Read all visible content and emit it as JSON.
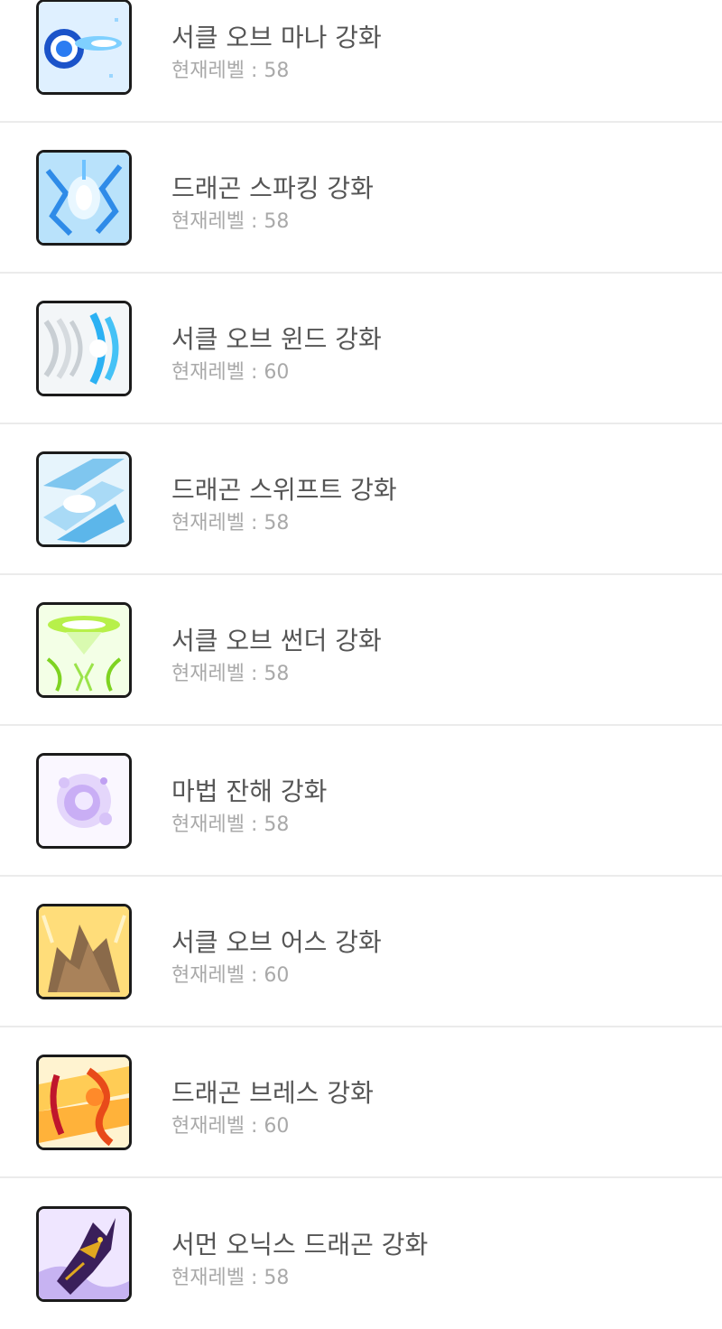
{
  "level_prefix": "현재레벨 : ",
  "skills": [
    {
      "name": "서클 오브 마나 강화",
      "level_text": "현재레벨 : 58",
      "icon": "circle-of-mana-icon",
      "color": "#2f8ff0"
    },
    {
      "name": "드래곤 스파킹 강화",
      "level_text": "현재레벨 : 58",
      "icon": "dragon-sparking-icon",
      "color": "#3aa7f0"
    },
    {
      "name": "서클 오브 윈드 강화",
      "level_text": "현재레벨 : 60",
      "icon": "circle-of-wind-icon",
      "color": "#2db4f5"
    },
    {
      "name": "드래곤 스위프트 강화",
      "level_text": "현재레벨 : 58",
      "icon": "dragon-swift-icon",
      "color": "#5cb6ea"
    },
    {
      "name": "서클 오브 썬더 강화",
      "level_text": "현재레벨 : 58",
      "icon": "circle-of-thunder-icon",
      "color": "#7ed321"
    },
    {
      "name": "마법 잔해 강화",
      "level_text": "현재레벨 : 58",
      "icon": "magic-debris-icon",
      "color": "#b28cf0"
    },
    {
      "name": "서클 오브 어스 강화",
      "level_text": "현재레벨 : 60",
      "icon": "circle-of-earth-icon",
      "color": "#a07850"
    },
    {
      "name": "드래곤 브레스 강화",
      "level_text": "현재레벨 : 60",
      "icon": "dragon-breath-icon",
      "color": "#e84a1a"
    },
    {
      "name": "서먼 오닉스 드래곤 강화",
      "level_text": "현재레벨 : 58",
      "icon": "summon-onyx-dragon-icon",
      "color": "#5a2a8a"
    }
  ]
}
